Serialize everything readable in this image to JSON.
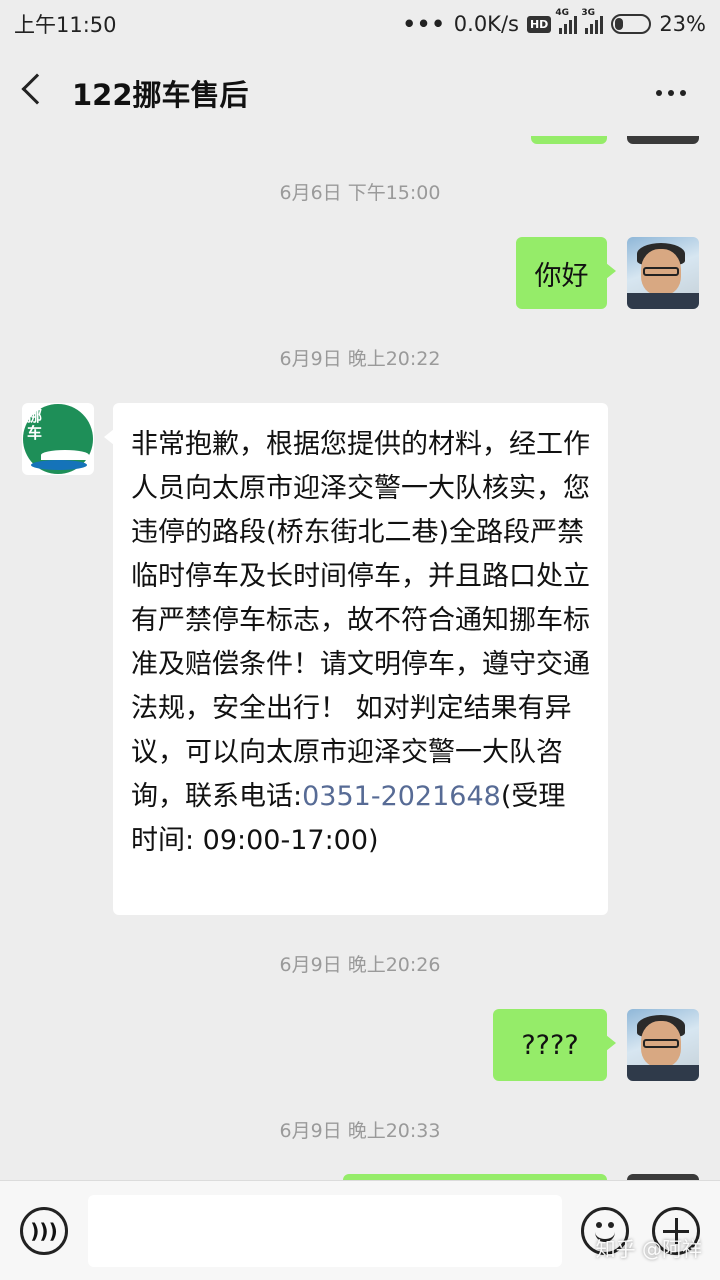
{
  "status_bar": {
    "time": "上午11:50",
    "network_speed": "0.0K/s",
    "hd_badge": "HD",
    "signal1_tag": "4G",
    "signal2_tag": "3G",
    "battery": "23%",
    "battery_level": 0.23
  },
  "header": {
    "title": "122挪车售后",
    "back_icon": "chevron-left-icon",
    "more_icon": "more-dots-icon"
  },
  "messages": [
    {
      "type": "timestamp",
      "text": "6月6日 下午15:00"
    },
    {
      "type": "sent",
      "text": "你好"
    },
    {
      "type": "timestamp",
      "text": "6月9日 晚上20:22"
    },
    {
      "type": "received",
      "text_part1": "非常抱歉，根据您提供的材料，经工作人员向太原市迎泽交警一大队核实，您违停的路段(桥东街北二巷)全路段严禁临时停车及长时间停车，并且路口处立有严禁停车标志，故不符合通知挪车标准及赔偿条件！请文明停车，遵守交通法规，安全出行！ 如对判定结果有异议，可以向太原市迎泽交警一大队咨询，联系电话:",
      "phone": "0351-2021648",
      "text_part2": "(受理时间: 09:00-17:00)"
    },
    {
      "type": "timestamp",
      "text": "6月9日 晚上20:26"
    },
    {
      "type": "sent",
      "text": "????"
    },
    {
      "type": "timestamp",
      "text": "6月9日 晚上20:33"
    }
  ],
  "logo_text": "挪车",
  "input_bar": {
    "placeholder": "",
    "voice_icon": "voice-icon",
    "emoji_icon": "emoji-icon",
    "plus_icon": "plus-icon"
  },
  "watermark": "知乎 @阿祥",
  "colors": {
    "sent_bubble": "#95ec69",
    "received_bubble": "#ffffff",
    "background": "#ededed",
    "link": "#576b95"
  }
}
